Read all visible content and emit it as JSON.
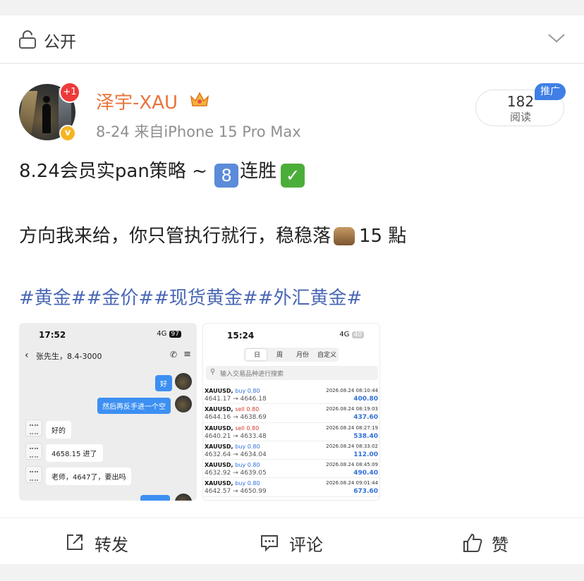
{
  "privacy": {
    "label": "公开",
    "icon": "lock-icon"
  },
  "author": {
    "name": "泽宇-XAU",
    "notification_badge": "+1",
    "verified_mark": "v",
    "meta": "8-24  来自iPhone 15 Pro Max"
  },
  "views": {
    "count": "182",
    "label": "阅读",
    "promo": "推广"
  },
  "post": {
    "line1_prefix": "8.24会员实pan策略 ~",
    "line1_num": "8",
    "line1_suffix": "连胜",
    "line1_check": "✓",
    "line2_prefix": "方向我来给，你只管执行就行，稳稳落",
    "line2_suffix": "15 點",
    "tags": "#黄金##金价##现货黄金##外汇黄金#"
  },
  "chat_shot": {
    "time": "17:52",
    "signal": "4G",
    "battery": "97",
    "contact": "张先生，8.4-3000",
    "messages": [
      {
        "side": "right",
        "text": "好"
      },
      {
        "side": "right",
        "text": "然后再反手进一个空"
      },
      {
        "side": "left",
        "text": "好的"
      },
      {
        "side": "left",
        "text": "4658.15 进了"
      },
      {
        "side": "left",
        "text": "老师，4647了，要出吗"
      }
    ]
  },
  "trade_shot": {
    "time": "15:24",
    "signal": "4G",
    "battery": "40",
    "tabs": [
      "日",
      "周",
      "月份",
      "自定义"
    ],
    "search_placeholder": "输入交易品种进行搜索",
    "trades": [
      {
        "symbol": "XAUUSD,",
        "dir": "buy 0.80",
        "date": "2026.08.24 08:10:44",
        "prices": "4641.17 → 4646.18",
        "profit": "400.80"
      },
      {
        "symbol": "XAUUSD,",
        "dir": "sell 0.80",
        "date": "2026.08.24 08:19:03",
        "prices": "4644.16 → 4638.69",
        "profit": "437.60"
      },
      {
        "symbol": "XAUUSD,",
        "dir": "sell 0.80",
        "date": "2026.08.24 08:27:19",
        "prices": "4640.21 → 4633.48",
        "profit": "538.40"
      },
      {
        "symbol": "XAUUSD,",
        "dir": "buy 0.80",
        "date": "2026.08.24 08:33:02",
        "prices": "4632.64 → 4634.04",
        "profit": "112.00"
      },
      {
        "symbol": "XAUUSD,",
        "dir": "buy 0.80",
        "date": "2026.08.24 08:45:09",
        "prices": "4632.92 → 4639.05",
        "profit": "490.40"
      },
      {
        "symbol": "XAUUSD,",
        "dir": "buy 0.80",
        "date": "2026.08.24 09:01:44",
        "prices": "4642.57 → 4650.99",
        "profit": "673.60"
      }
    ]
  },
  "actions": {
    "repost": "转发",
    "comment": "评论",
    "like": "赞"
  },
  "colors": {
    "username": "#e8743b",
    "tags": "#4a67b5",
    "buy": "#2f6fd6",
    "sell": "#d23a2a",
    "promo": "#3f7fe6"
  }
}
